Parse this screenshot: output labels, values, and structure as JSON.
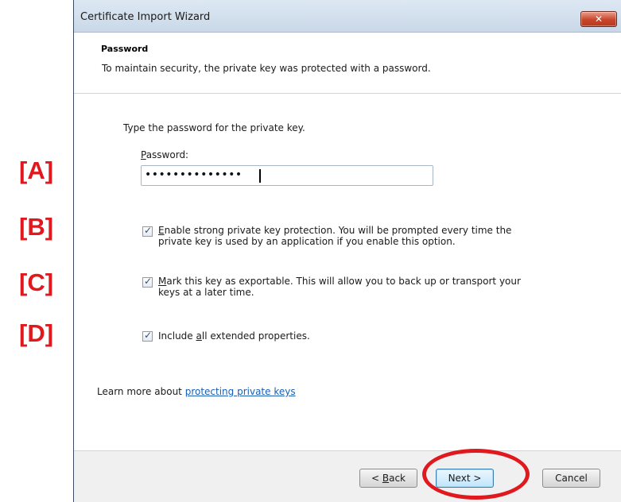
{
  "markers": [
    "[A]",
    "[B]",
    "[C]",
    "[D]"
  ],
  "window": {
    "title": "Certificate Import Wizard",
    "close_glyph": "✕"
  },
  "header": {
    "title": "Password",
    "subtitle": "To maintain security, the private key was protected with a password."
  },
  "body": {
    "instruction": "Type the password for the private key.",
    "password_label_accel": "P",
    "password_label_rest": "assword:",
    "password_value": "••••••••••••••"
  },
  "options": [
    {
      "checked": true,
      "accel": "E",
      "line1_rest": "nable strong private key protection. You will be prompted every time the",
      "line2": "private key is used by an application if you enable this option."
    },
    {
      "checked": true,
      "accel": "M",
      "line1_rest": "ark this key as exportable. This will allow you to back up or transport your",
      "line2": "keys at a later time."
    },
    {
      "checked": true,
      "pre": "Include ",
      "accel": "a",
      "line1_rest": "ll extended properties."
    }
  ],
  "learn_more": {
    "prefix": "Learn more about ",
    "link": "protecting private keys"
  },
  "buttons": {
    "back_prefix": "< ",
    "back_accel": "B",
    "back_rest": "ack",
    "next": "Next >",
    "cancel": "Cancel"
  },
  "colors": {
    "marker": "#e0191e",
    "link": "#1a5fb4",
    "close": "#c8452a"
  },
  "icons": {
    "close": "close-icon",
    "checkbox": "checkbox-checked-icon"
  }
}
